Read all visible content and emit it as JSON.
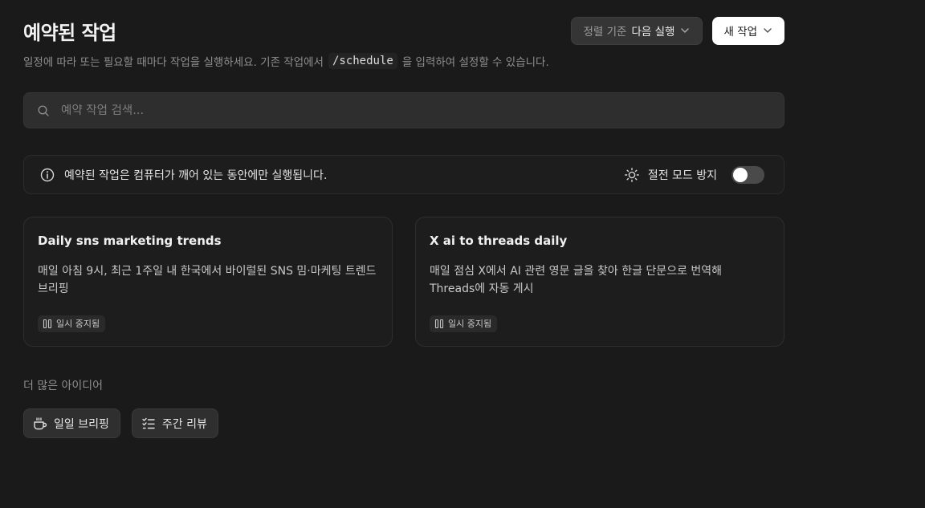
{
  "header": {
    "title": "예약된 작업",
    "sort_prefix": "정렬 기준",
    "sort_value": "다음 실행",
    "new_task_label": "새 작업"
  },
  "subtitle": {
    "before": "일정에 따라 또는 필요할 때마다 작업을 실행하세요. 기존 작업에서",
    "command": "/schedule",
    "after": "을 입력하여 설정할 수 있습니다."
  },
  "search": {
    "placeholder": "예약 작업 검색..."
  },
  "banner": {
    "message": "예약된 작업은 컴퓨터가 깨어 있는 동안에만 실행됩니다.",
    "sleep_label": "절전 모드 방지",
    "sleep_toggle_on": false
  },
  "tasks": [
    {
      "title": "Daily sns marketing trends",
      "description": "매일 아침 9시, 최근 1주일 내 한국에서 바이럴된 SNS 밈·마케팅 트렌드 브리핑",
      "status": "일시 중지됨"
    },
    {
      "title": "X ai to threads daily",
      "description": "매일 점심 X에서 AI 관련 영문 글을 찾아 한글 단문으로 번역해 Threads에 자동 게시",
      "status": "일시 중지됨"
    }
  ],
  "more_ideas": {
    "label": "더 많은 아이디어",
    "items": [
      {
        "label": "일일 브리핑",
        "icon": "coffee-cup-icon"
      },
      {
        "label": "주간 리뷰",
        "icon": "checklist-icon"
      }
    ]
  }
}
